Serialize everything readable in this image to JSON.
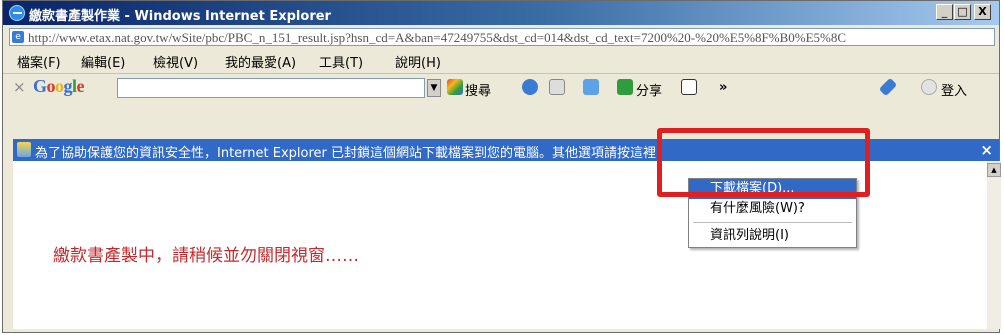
{
  "window": {
    "title": "繳款書產製作業 - Windows Internet Explorer",
    "minimize": "_",
    "restore": "□",
    "close": "X"
  },
  "address": {
    "url": "http://www.etax.nat.gov.tw/wSite/pbc/PBC_n_151_result.jsp?hsn_cd=A&ban=47249755&dst_cd=014&dst_cd_text=7200%20-%20%E5%8F%B0%E5%8C"
  },
  "menu": [
    "檔案(F)",
    "編輯(E)",
    "檢視(V)",
    "我的最愛(A)",
    "工具(T)",
    "說明(H)"
  ],
  "google_toolbar": {
    "close": "×",
    "logo": "Google",
    "search_label": "搜尋",
    "share_label": "分享",
    "more": "»",
    "login_label": "登入"
  },
  "infobar": {
    "message": "為了協助保護您的資訊安全性，Internet Explorer 已封鎖這個網站下載檔案到您的電腦。其他選項請按這裡",
    "close": "×"
  },
  "context_menu": {
    "items": [
      "下載檔案(D)...",
      "有什麼風險(W)?",
      "資訊列說明(I)"
    ]
  },
  "page": {
    "loading_text": "繳款書產製中，請稍候並勿關閉視窗……"
  },
  "colors": {
    "accent": "#3169c6",
    "highlight_box": "#e02020",
    "loading_text": "#c8282b"
  }
}
